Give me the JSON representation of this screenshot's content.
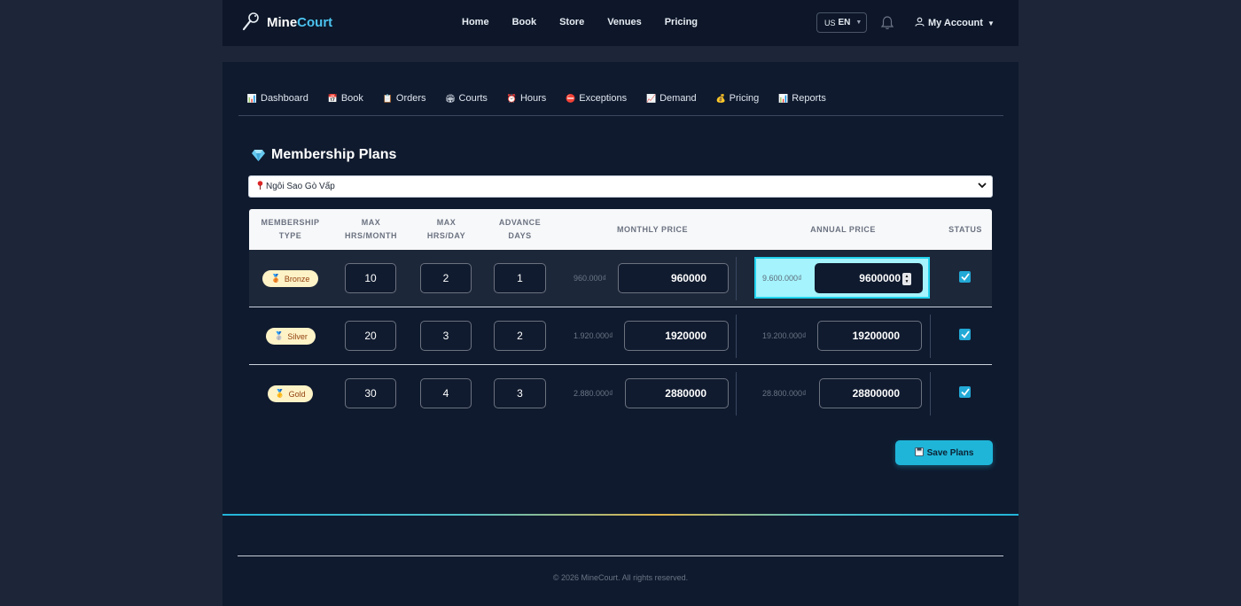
{
  "header": {
    "brand_part1": "Mine",
    "brand_part2": "Court",
    "nav": [
      "Home",
      "Book",
      "Store",
      "Venues",
      "Pricing"
    ],
    "language": "EN",
    "language_flag": "US",
    "account": "My Account"
  },
  "tabs": [
    {
      "icon": "📊",
      "label": "Dashboard"
    },
    {
      "icon": "📅",
      "label": "Book"
    },
    {
      "icon": "📋",
      "label": "Orders"
    },
    {
      "icon": "🏟",
      "label": "Courts"
    },
    {
      "icon": "⏰",
      "label": "Hours"
    },
    {
      "icon": "⛔",
      "label": "Exceptions"
    },
    {
      "icon": "📈",
      "label": "Demand"
    },
    {
      "icon": "💰",
      "label": "Pricing"
    },
    {
      "icon": "📊",
      "label": "Reports"
    }
  ],
  "page": {
    "title": "Membership Plans",
    "venue_selected": "Ngôi Sao Gò Vấp"
  },
  "table": {
    "headers": {
      "type": [
        "MEMBERSHIP",
        "TYPE"
      ],
      "hrs_month": [
        "MAX",
        "HRS/MONTH"
      ],
      "hrs_day": [
        "MAX",
        "HRS/DAY"
      ],
      "advance": [
        "ADVANCE",
        "DAYS"
      ],
      "monthly": "MONTHLY PRICE",
      "annual": "ANNUAL PRICE",
      "status": "STATUS"
    },
    "rows": [
      {
        "type": "Bronze",
        "hrs_month": "10",
        "hrs_day": "2",
        "advance_days": "1",
        "monthly_ref": "960.000₫",
        "monthly": "960000",
        "annual_ref": "9.600.000₫",
        "annual": "9600000",
        "active": true
      },
      {
        "type": "Silver",
        "hrs_month": "20",
        "hrs_day": "3",
        "advance_days": "2",
        "monthly_ref": "1.920.000₫",
        "monthly": "1920000",
        "annual_ref": "19.200.000₫",
        "annual": "19200000",
        "active": true
      },
      {
        "type": "Gold",
        "hrs_month": "30",
        "hrs_day": "4",
        "advance_days": "3",
        "monthly_ref": "2.880.000₫",
        "monthly": "2880000",
        "annual_ref": "28.800.000₫",
        "annual": "28800000",
        "active": true
      }
    ]
  },
  "save_button": "Save Plans",
  "footer": {
    "copyright": "© 2026 MineCourt. All rights reserved."
  },
  "colors": {
    "accent": "#1fb5d9",
    "badge_bg": "#fef3c7",
    "page_bg": "#0f1a2e"
  }
}
